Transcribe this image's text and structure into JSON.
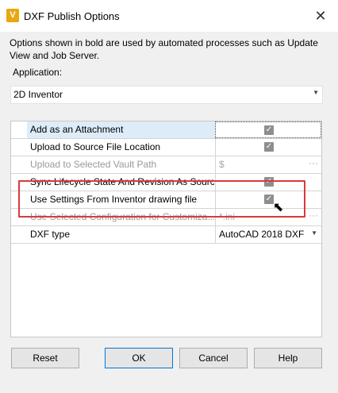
{
  "window": {
    "title": "DXF Publish Options",
    "icon_letter": "V",
    "close_glyph": "✕"
  },
  "description": "Options shown in bold are used by automated processes such as Update View and Job Server.",
  "application": {
    "label": "Application:",
    "selected": "2D Inventor"
  },
  "grid": {
    "rows": [
      {
        "name": "Add as an Attachment",
        "value_type": "checkbox",
        "checked": true,
        "selected": true,
        "enabled": true
      },
      {
        "name": "Upload to Source File Location",
        "value_type": "checkbox",
        "checked": true,
        "enabled": true
      },
      {
        "name": "Upload to Selected Vault Path",
        "value_type": "text",
        "value": "$",
        "enabled": false
      },
      {
        "name": "Sync Lifecycle State And Revision As Source",
        "value_type": "checkbox",
        "checked": true,
        "enabled": true
      },
      {
        "name": "Use Settings From Inventor drawing file",
        "value_type": "checkbox",
        "checked": true,
        "enabled": true
      },
      {
        "name": "Use Selected Configuration for Customiza...",
        "value_type": "text",
        "value": "*.ini",
        "enabled": false
      },
      {
        "name": "DXF type",
        "value_type": "select",
        "value": "AutoCAD 2018 DXF",
        "enabled": true
      }
    ],
    "ellipsis": "···"
  },
  "buttons": {
    "reset": "Reset",
    "ok": "OK",
    "cancel": "Cancel",
    "help": "Help"
  },
  "colors": {
    "highlight": "#d93a3a",
    "accent": "#0078d7",
    "selected_row": "#dcecf9"
  }
}
